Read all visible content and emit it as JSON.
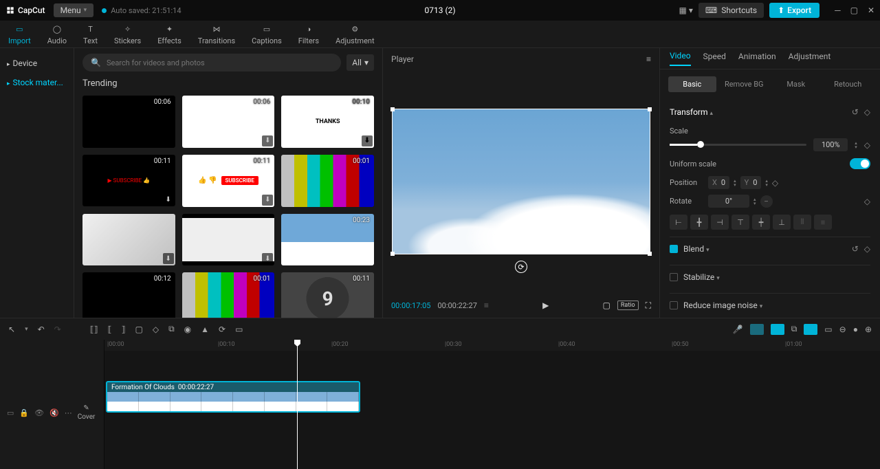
{
  "app": {
    "name": "CapCut",
    "menu": "Menu",
    "autosave": "Auto saved: 21:51:14",
    "project": "0713 (2)",
    "shortcuts": "Shortcuts",
    "export": "Export"
  },
  "tooltabs": [
    "Import",
    "Audio",
    "Text",
    "Stickers",
    "Effects",
    "Transitions",
    "Captions",
    "Filters",
    "Adjustment"
  ],
  "leftnav": {
    "device": "Device",
    "stock": "Stock mater..."
  },
  "media": {
    "search_placeholder": "Search for videos and photos",
    "filter": "All",
    "trending": "Trending",
    "thumbs": [
      {
        "dur": "00:06"
      },
      {
        "dur": "00:06"
      },
      {
        "dur": "00:10",
        "text": "THANKS"
      },
      {
        "dur": "00:11"
      },
      {
        "dur": "00:11",
        "sub": "SUBSCRIBE"
      },
      {
        "dur": "00:01"
      },
      {
        "dur": ""
      },
      {
        "dur": ""
      },
      {
        "dur": "00:23"
      },
      {
        "dur": "00:12"
      },
      {
        "dur": "00:01"
      },
      {
        "dur": "00:11",
        "num": "9"
      }
    ]
  },
  "player": {
    "title": "Player",
    "current": "00:00:17:05",
    "total": "00:00:22:27",
    "ratio": "Ratio"
  },
  "inspector": {
    "tabs": [
      "Video",
      "Speed",
      "Animation",
      "Adjustment"
    ],
    "subtabs": [
      "Basic",
      "Remove BG",
      "Mask",
      "Retouch"
    ],
    "transform": "Transform",
    "scale": "Scale",
    "scale_val": "100%",
    "uniform": "Uniform scale",
    "position": "Position",
    "x_lbl": "X",
    "x_val": "0",
    "y_lbl": "Y",
    "y_val": "0",
    "rotate": "Rotate",
    "rotate_val": "0°",
    "blend": "Blend",
    "stabilize": "Stabilize",
    "noise": "Reduce image noise"
  },
  "timeline": {
    "marks": [
      "|00:00",
      "|00:10",
      "|00:20",
      "|00:30",
      "|00:40",
      "|00:50",
      "|01:00"
    ],
    "clip_name": "Formation Of Clouds",
    "clip_dur": "00:00:22:27",
    "cover": "Cover"
  }
}
